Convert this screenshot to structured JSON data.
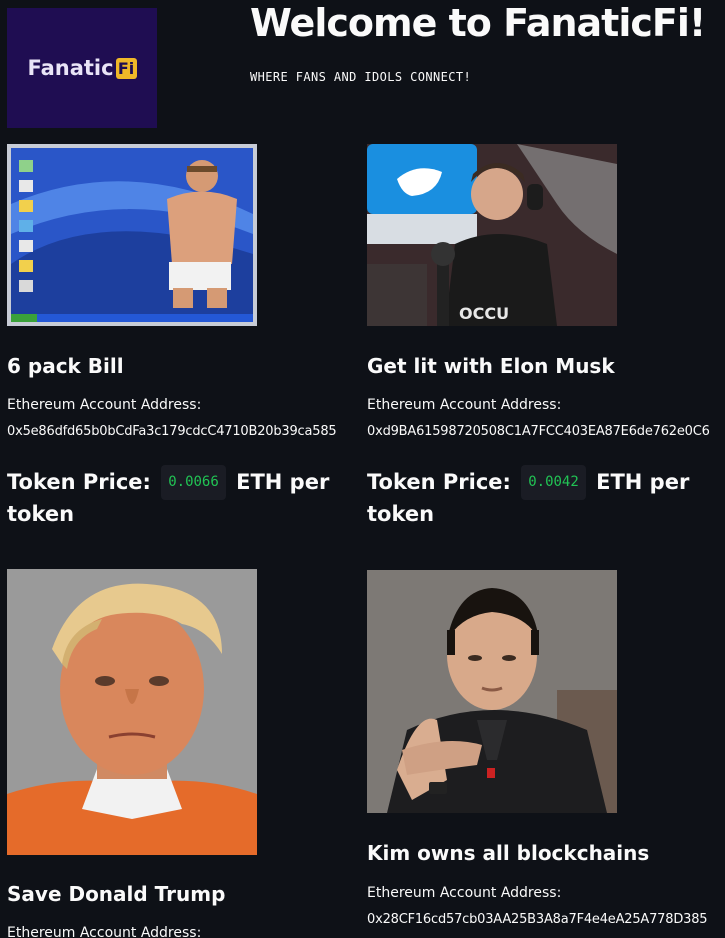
{
  "app": {
    "logo_text": "Fanatic",
    "logo_badge": "Fi",
    "title": "Welcome to FanaticFi!",
    "tagline": "WHERE FANS AND IDOLS CONNECT!"
  },
  "cards": [
    {
      "name": "6 pack Bill",
      "address_label": "Ethereum Account Address:",
      "address": "0x5e86dfd65b0bCdFa3c179cdcC4710B20b39ca585",
      "price_label": "Token Price:",
      "price": "0.0066",
      "price_unit": "ETH per token"
    },
    {
      "name": "Get lit with Elon Musk",
      "address_label": "Ethereum Account Address:",
      "address": "0xd9BA61598720508C1A7FCC403EA87E6de762e0C6",
      "price_label": "Token Price:",
      "price": "0.0042",
      "price_unit": "ETH per token"
    },
    {
      "name": "Save Donald Trump",
      "address_label": "Ethereum Account Address:"
    },
    {
      "name": "Kim owns all blockchains",
      "address_label": "Ethereum Account Address:",
      "address": "0x28CF16cd57cb03AA25B3A8a7F4e4eA25A778D385"
    }
  ],
  "colors": {
    "background": "#0e1117",
    "logo_bg": "#1f0d52",
    "price_green": "#21c354"
  }
}
